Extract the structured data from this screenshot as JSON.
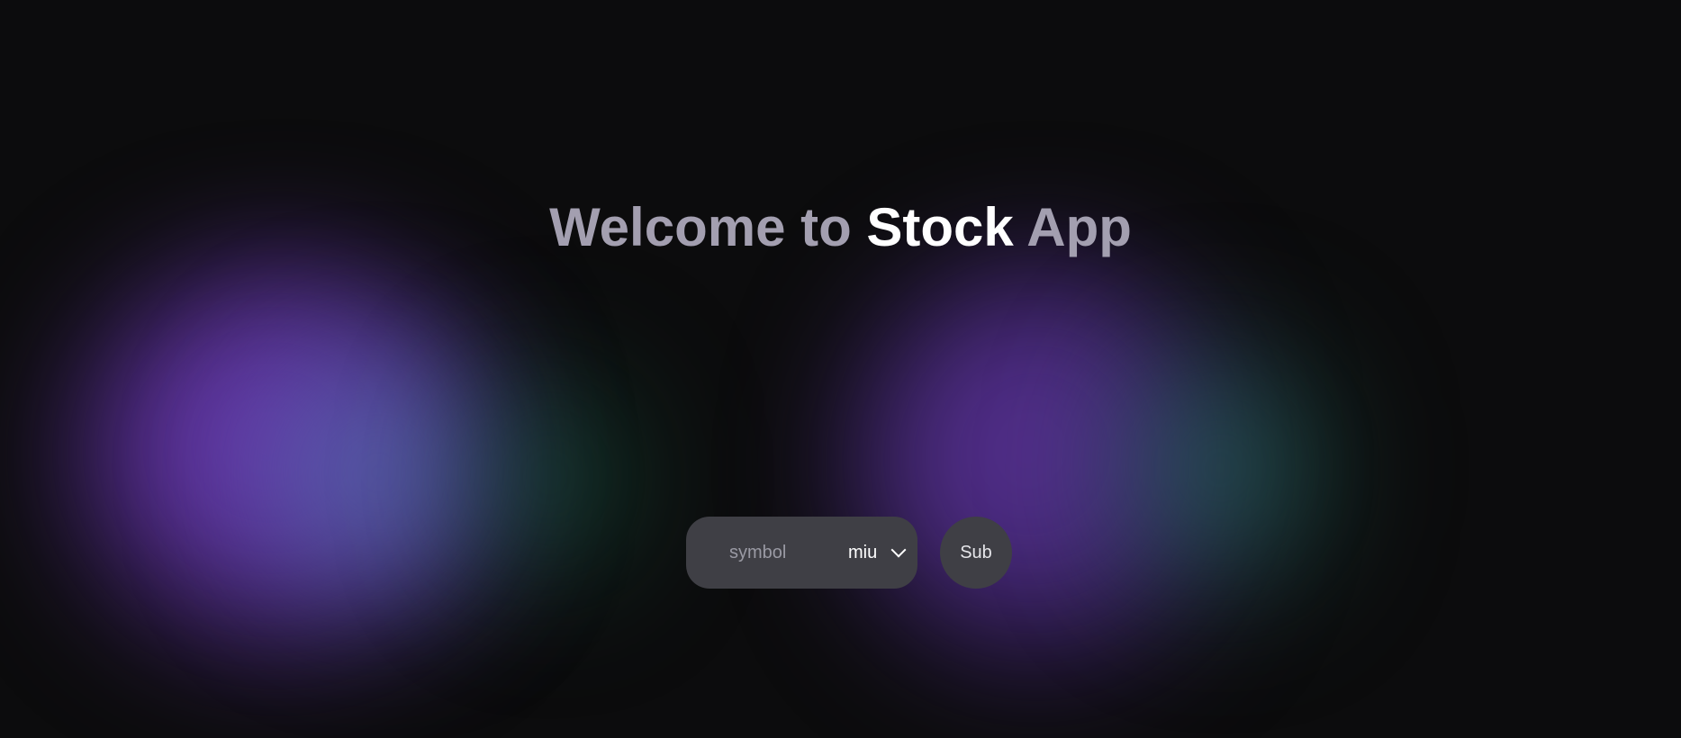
{
  "hero": {
    "title_part1": "Welcome to ",
    "title_part2": "Stock",
    "title_part3": " App"
  },
  "form": {
    "symbol_placeholder": "symbol",
    "symbol_value": "",
    "select_value": "miu",
    "submit_label": "Sub"
  },
  "icons": {
    "select": "chevron-down-icon"
  },
  "colors": {
    "background": "#0c0c0d",
    "title_muted": "#a39fb0",
    "title_strong": "#ffffff",
    "control_bg": "#3f3f45",
    "blob_purple": "#5a2f98",
    "blob_blue": "#5a73b4",
    "blob_green": "#1e6e50"
  }
}
